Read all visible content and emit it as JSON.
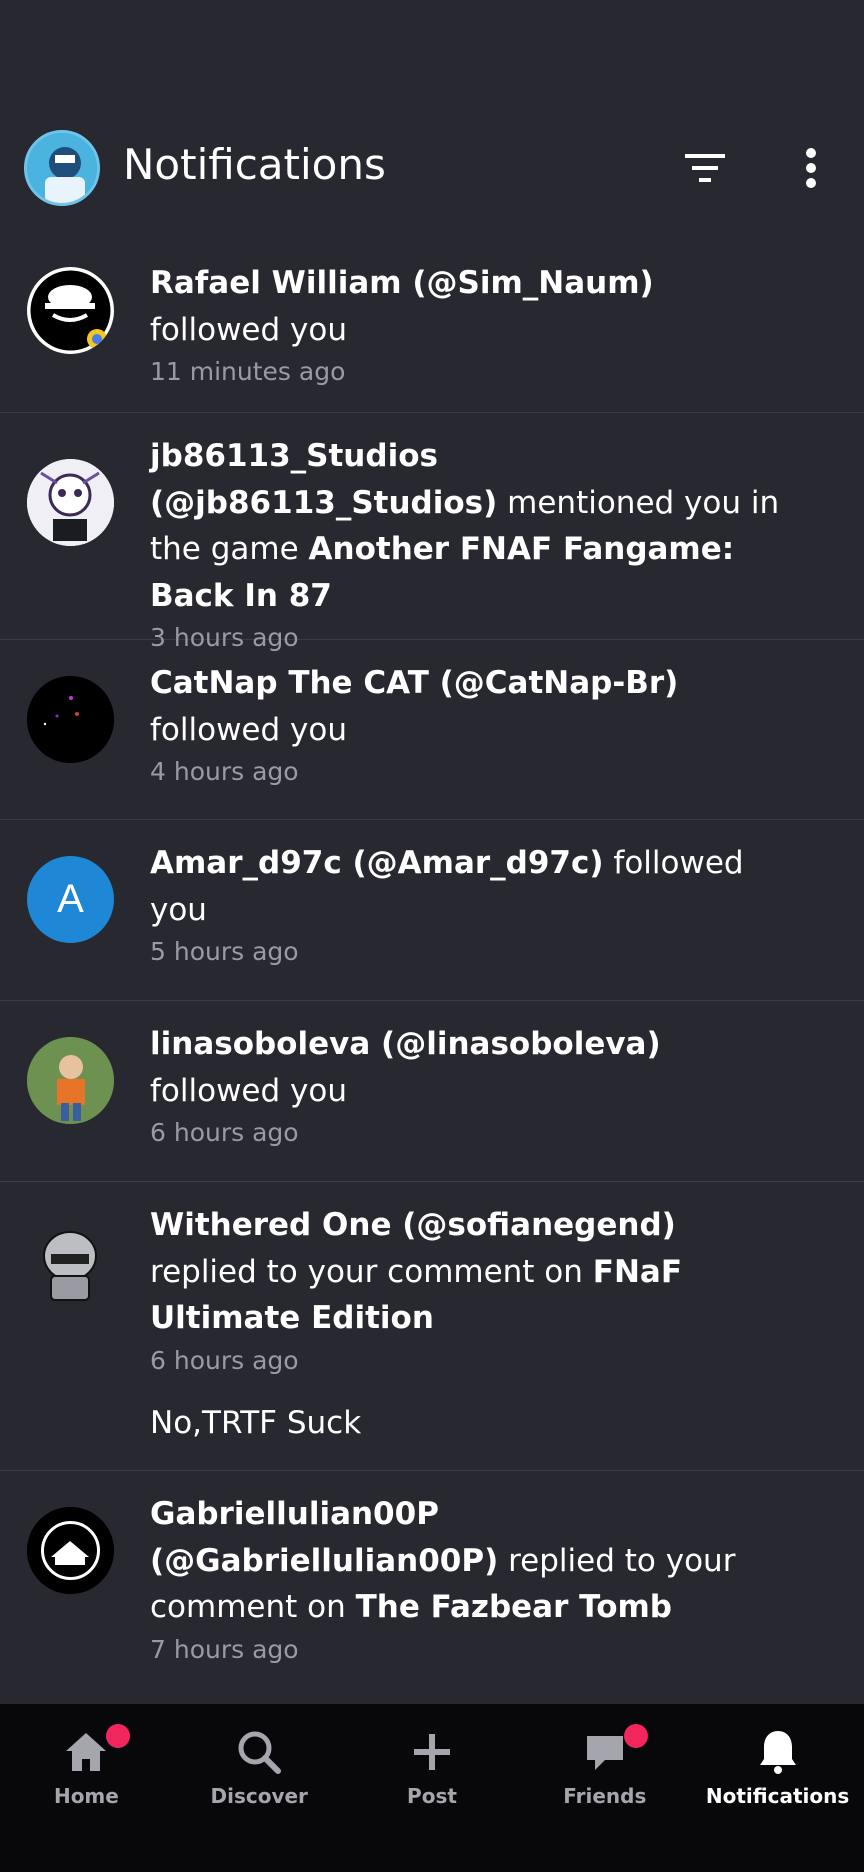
{
  "header": {
    "title": "Notifications"
  },
  "notifications": [
    {
      "name": "Rafael William (@Sim_Naum)",
      "action": " followed you",
      "time": "11 minutes ago"
    },
    {
      "name": "jb86113_Studios (@jb86113_Studios)",
      "action": " mentioned you in the game ",
      "target": "Another FNAF Fangame: Back In 87",
      "time": "3 hours ago"
    },
    {
      "name": "CatNap The CAT (@CatNap-Br)",
      "action": " followed you",
      "time": "4 hours ago"
    },
    {
      "name": "Amar_d97c (@Amar_d97c)",
      "action": " followed you",
      "time": "5 hours ago",
      "avatar_letter": "A"
    },
    {
      "name": "linasoboleva (@linasoboleva)",
      "action": " followed you",
      "time": "6 hours ago"
    },
    {
      "name": "Withered One (@sofianegend)",
      "action": " replied to your comment on ",
      "target": "FNaF Ultimate Edition",
      "time": "6 hours ago",
      "reply": "No,TRTF Suck"
    },
    {
      "name": "Gabriellulian00P (@Gabriellulian00P)",
      "action": " replied to your comment on ",
      "target": "The Fazbear Tomb",
      "time": "7 hours ago"
    }
  ],
  "bottom_nav": [
    {
      "label": "Home",
      "icon": "home-icon",
      "badge": true
    },
    {
      "label": "Discover",
      "icon": "search-icon",
      "badge": false
    },
    {
      "label": "Post",
      "icon": "plus-icon",
      "badge": false
    },
    {
      "label": "Friends",
      "icon": "chat-icon",
      "badge": true
    },
    {
      "label": "Notifications",
      "icon": "bell-icon",
      "badge": false,
      "active": true
    }
  ],
  "colors": {
    "background": "#282831",
    "nav_background": "#08080a",
    "badge": "#f0265c",
    "muted_text": "#9a9aa3"
  }
}
